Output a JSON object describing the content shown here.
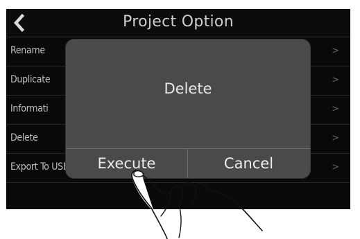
{
  "header": {
    "title": "Project Option",
    "back_icon": "chevron-left-icon"
  },
  "menu": {
    "items": [
      {
        "label": "Rename",
        "arrow": ">"
      },
      {
        "label": "Duplicate",
        "arrow": ">"
      },
      {
        "label": "Informati",
        "arrow": ">"
      },
      {
        "label": "Delete",
        "arrow": ">"
      },
      {
        "label": "Export To USB Memory",
        "arrow": ">"
      }
    ]
  },
  "dialog": {
    "message": "Delete",
    "execute_label": "Execute",
    "cancel_label": "Cancel"
  },
  "colors": {
    "screen_bg": "#0a0a0a",
    "dialog_bg": "#4a4a4a",
    "text": "#e8e8e8"
  },
  "illustration": {
    "hand_icon": "pointing-hand-icon"
  }
}
